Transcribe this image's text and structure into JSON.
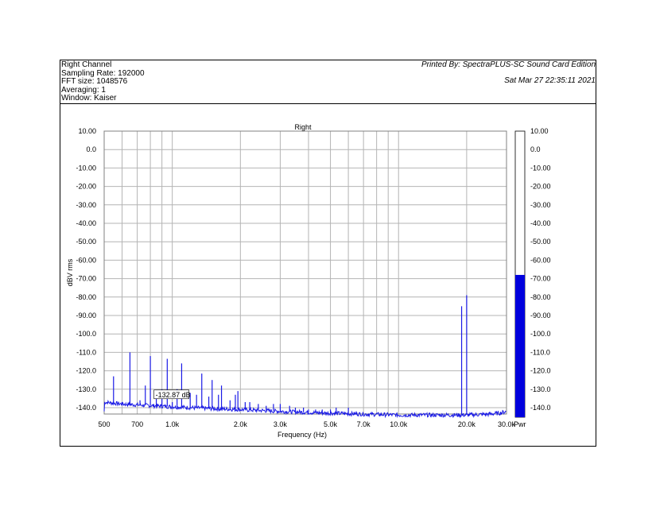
{
  "header": {
    "channel": "Right Channel",
    "sampling_rate": "Sampling Rate: 192000",
    "fft_size": "FFT size: 1048576",
    "averaging": "Averaging: 1",
    "window": "Window: Kaiser",
    "printed_by": "Printed By: SpectraPLUS-SC Sound Card Edition",
    "timestamp": "Sat Mar 27 22:35:11 2021"
  },
  "colors": {
    "trace": "#1a1ae6",
    "grid": "#b4b4b4",
    "meter": "#0000dd"
  },
  "chart_data": {
    "type": "line",
    "title": "Right",
    "xlabel": "Frequency (Hz)",
    "ylabel": "dBV rms",
    "x_scale": "log",
    "xlim": [
      500,
      30000
    ],
    "ylim": [
      -145,
      10
    ],
    "x_ticks": [
      {
        "v": 500,
        "label": "500"
      },
      {
        "v": 700,
        "label": "700"
      },
      {
        "v": 1000,
        "label": "1.0k"
      },
      {
        "v": 2000,
        "label": "2.0k"
      },
      {
        "v": 3000,
        "label": "3.0k"
      },
      {
        "v": 5000,
        "label": "5.0k"
      },
      {
        "v": 7000,
        "label": "7.0k"
      },
      {
        "v": 10000,
        "label": "10.0k"
      },
      {
        "v": 20000,
        "label": "20.0k"
      },
      {
        "v": 30000,
        "label": "30.0k"
      }
    ],
    "y_ticks": [
      {
        "v": 10,
        "label": "10.00"
      },
      {
        "v": 0,
        "label": "0.0"
      },
      {
        "v": -10,
        "label": "-10.00"
      },
      {
        "v": -20,
        "label": "-20.00"
      },
      {
        "v": -30,
        "label": "-30.00"
      },
      {
        "v": -40,
        "label": "-40.00"
      },
      {
        "v": -50,
        "label": "-50.00"
      },
      {
        "v": -60,
        "label": "-60.00"
      },
      {
        "v": -70,
        "label": "-70.00"
      },
      {
        "v": -80,
        "label": "-80.00"
      },
      {
        "v": -90,
        "label": "-90.00"
      },
      {
        "v": -100,
        "label": "-100.0"
      },
      {
        "v": -110,
        "label": "-110.0"
      },
      {
        "v": -120,
        "label": "-120.0"
      },
      {
        "v": -130,
        "label": "-130.0"
      },
      {
        "v": -140,
        "label": "-140.0"
      }
    ],
    "noise_floor": [
      [
        500,
        -137
      ],
      [
        600,
        -138
      ],
      [
        700,
        -138.5
      ],
      [
        1000,
        -139.5
      ],
      [
        1500,
        -140.5
      ],
      [
        2000,
        -141
      ],
      [
        3000,
        -142
      ],
      [
        5000,
        -143
      ],
      [
        7000,
        -143.5
      ],
      [
        10000,
        -144
      ],
      [
        15000,
        -144
      ],
      [
        20000,
        -144
      ],
      [
        25000,
        -143.5
      ],
      [
        28000,
        -143
      ],
      [
        30000,
        -142
      ]
    ],
    "peaks": [
      [
        550,
        -123
      ],
      [
        600,
        -137
      ],
      [
        650,
        -110
      ],
      [
        720,
        -136
      ],
      [
        760,
        -128
      ],
      [
        800,
        -112
      ],
      [
        850,
        -135
      ],
      [
        900,
        -130
      ],
      [
        950,
        -113.5
      ],
      [
        1000,
        -137
      ],
      [
        1050,
        -130
      ],
      [
        1100,
        -116
      ],
      [
        1200,
        -132
      ],
      [
        1280,
        -133
      ],
      [
        1350,
        -121.5
      ],
      [
        1450,
        -134
      ],
      [
        1500,
        -125
      ],
      [
        1600,
        -133
      ],
      [
        1650,
        -128
      ],
      [
        1800,
        -136
      ],
      [
        1900,
        -133
      ],
      [
        1950,
        -131
      ],
      [
        2100,
        -137
      ],
      [
        2200,
        -137
      ],
      [
        2400,
        -138
      ],
      [
        2600,
        -139
      ],
      [
        2800,
        -138
      ],
      [
        3000,
        -138
      ],
      [
        3300,
        -139
      ],
      [
        3500,
        -140
      ],
      [
        3800,
        -140
      ],
      [
        4000,
        -141
      ],
      [
        4300,
        -141
      ],
      [
        4600,
        -141
      ],
      [
        5000,
        -141
      ],
      [
        5300,
        -140
      ],
      [
        6000,
        -140
      ],
      [
        6500,
        -142
      ],
      [
        19000,
        -85
      ],
      [
        20000,
        -79
      ]
    ],
    "marker": {
      "x": 900,
      "y": -133,
      "label": "-132.87 dB"
    },
    "meter": {
      "label": "Pwr",
      "level": -68,
      "ticks": [
        {
          "v": 10,
          "label": "10.00"
        },
        {
          "v": 0,
          "label": "0.0"
        },
        {
          "v": -10,
          "label": "-10.00"
        },
        {
          "v": -20,
          "label": "-20.00"
        },
        {
          "v": -30,
          "label": "-30.00"
        },
        {
          "v": -40,
          "label": "-40.00"
        },
        {
          "v": -50,
          "label": "-50.00"
        },
        {
          "v": -60,
          "label": "-60.00"
        },
        {
          "v": -70,
          "label": "-70.00"
        },
        {
          "v": -80,
          "label": "-80.00"
        },
        {
          "v": -90,
          "label": "-90.00"
        },
        {
          "v": -100,
          "label": "-100.0"
        },
        {
          "v": -110,
          "label": "-110.0"
        },
        {
          "v": -120,
          "label": "-120.0"
        },
        {
          "v": -130,
          "label": "-130.0"
        },
        {
          "v": -140,
          "label": "-140.0"
        }
      ]
    }
  }
}
